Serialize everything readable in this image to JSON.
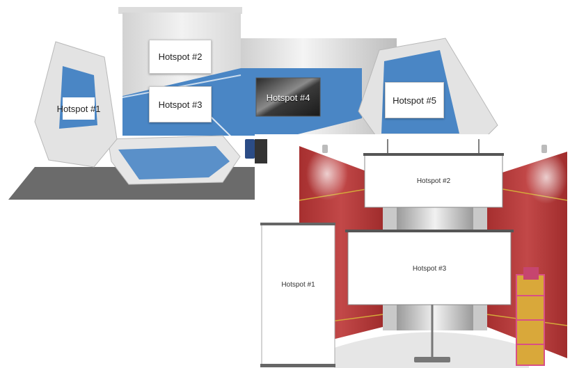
{
  "blue_booth": {
    "hotspots": {
      "h1": "Hotspot #1",
      "h2": "Hotspot #2",
      "h3": "Hotspot #3",
      "h4": "Hotspot #4",
      "h5": "Hotspot #5"
    },
    "colors": {
      "accent": "#4a86c5",
      "wall": "#e8e8e8",
      "floor": "#6a6a6a"
    }
  },
  "red_booth": {
    "hotspots": {
      "h1": "Hotspot #1",
      "h2": "Hotspot #2",
      "h3": "Hotspot #3"
    },
    "colors": {
      "wall": "#b53a3a",
      "panel": "#ffffff",
      "accent": "#d4a93a"
    }
  }
}
